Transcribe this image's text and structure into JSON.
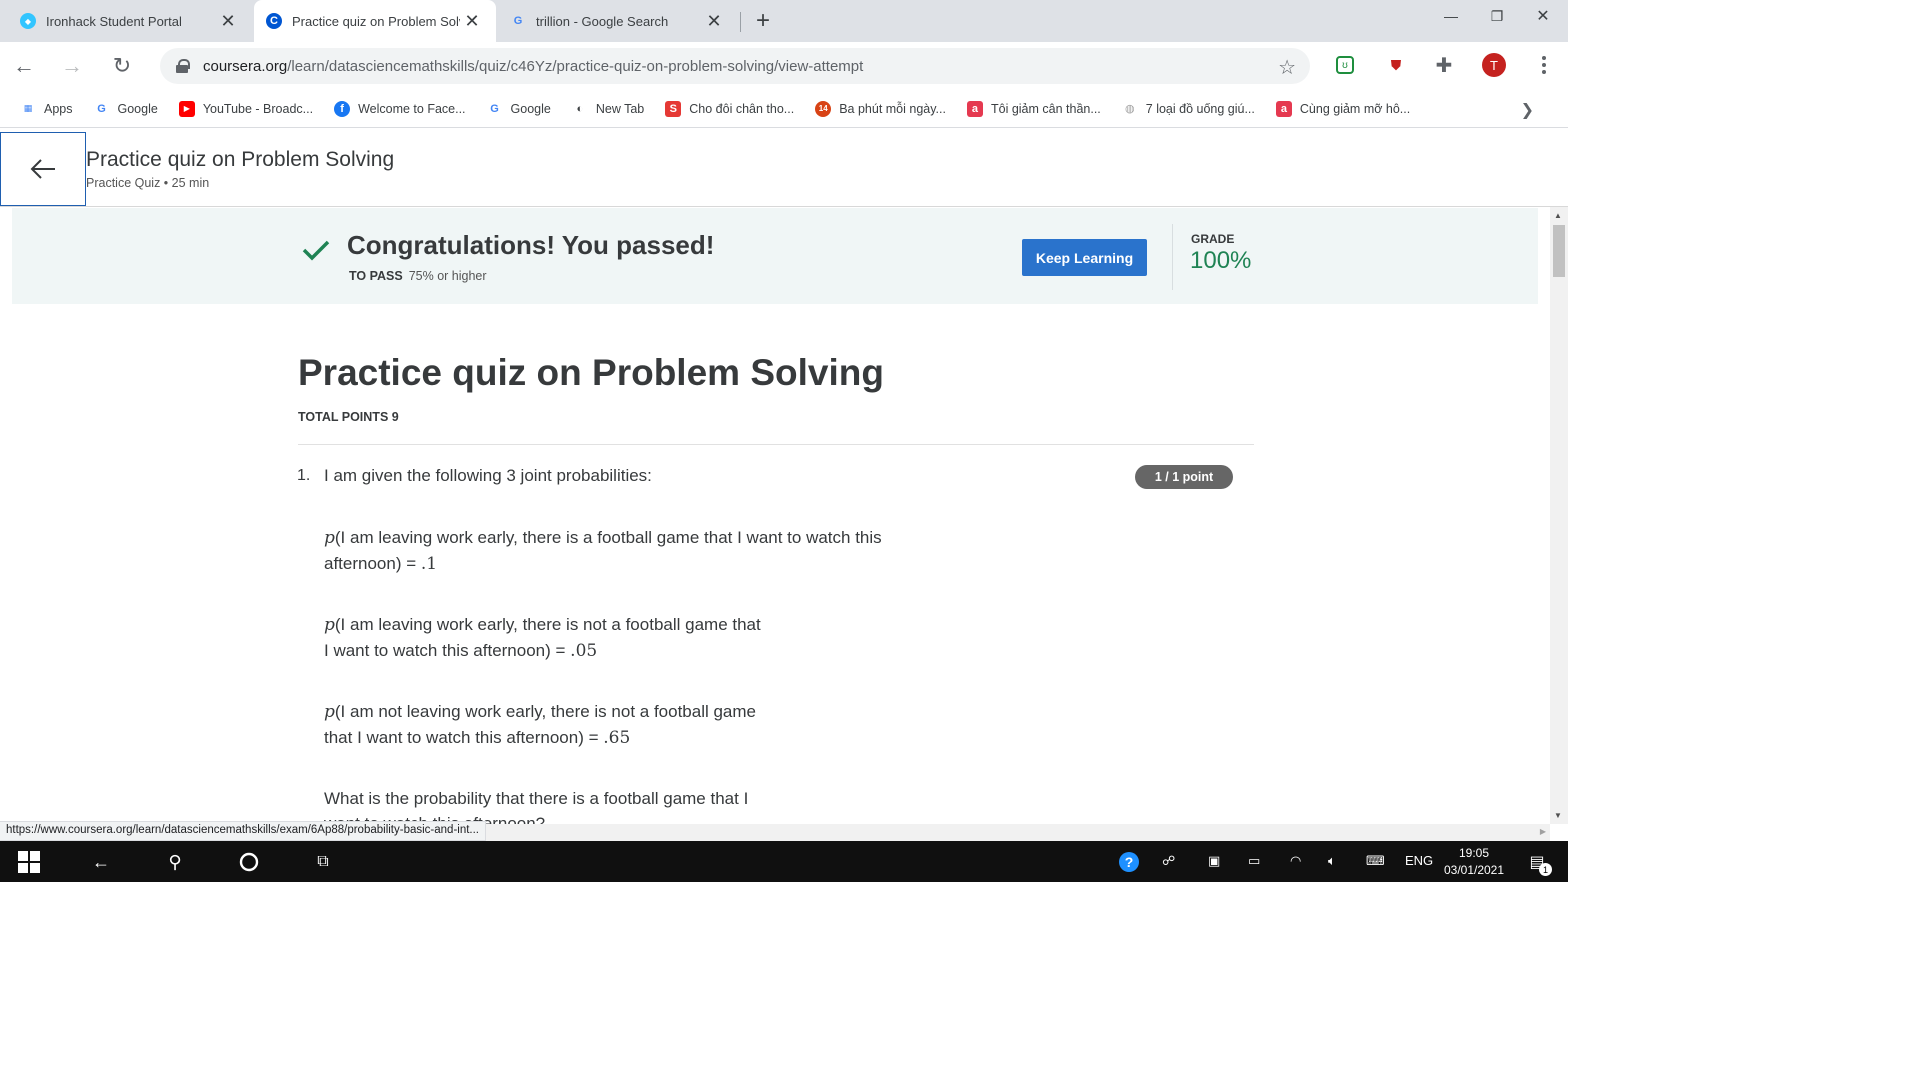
{
  "browser": {
    "tabs": [
      {
        "title": "Ironhack Student Portal",
        "icon": "ironhack-icon",
        "color": "#32c5ff",
        "active": false
      },
      {
        "title": "Practice quiz on Problem Solvi",
        "icon": "coursera-icon",
        "color": "#0056d2",
        "active": true
      },
      {
        "title": "trillion - Google Search",
        "icon": "google-icon",
        "color": "#4285f4",
        "active": false
      }
    ],
    "new_tab_symbol": "+",
    "url_domain": "coursera.org",
    "url_path": "/learn/datasciencemathskills/quiz/c46Yz/practice-quiz-on-problem-solving/view-attempt",
    "profile_initial": "T",
    "bookmarks": [
      {
        "label": "Apps",
        "icon": "apps-grid-icon",
        "glyph": "⋮⋮⋮",
        "color": "#4285f4"
      },
      {
        "label": "Google",
        "icon": "google-icon",
        "glyph": "G",
        "color": "#4285f4"
      },
      {
        "label": "YouTube - Broadc...",
        "icon": "youtube-icon",
        "glyph": "▶",
        "color": "#ff0000"
      },
      {
        "label": "Welcome to Face...",
        "icon": "facebook-icon",
        "glyph": "f",
        "color": "#1877f2"
      },
      {
        "label": "Google",
        "icon": "google-icon",
        "glyph": "G",
        "color": "#4285f4"
      },
      {
        "label": "New Tab",
        "icon": "new-tab-icon",
        "glyph": "◐",
        "color": "#3c4043"
      },
      {
        "label": "Cho đôi chân tho...",
        "icon": "s-icon",
        "glyph": "S",
        "color": "#e53935"
      },
      {
        "label": "Ba phút mỗi ngày...",
        "icon": "14-icon",
        "glyph": "14",
        "color": "#d84315"
      },
      {
        "label": "Tôi giảm cân thần...",
        "icon": "a-icon",
        "glyph": "a",
        "color": "#e53950"
      },
      {
        "label": "7 loại đồ uống giú...",
        "icon": "globe-icon",
        "glyph": "◍",
        "color": "#9e9e9e"
      },
      {
        "label": "Cùng giảm mỡ hô...",
        "icon": "a-icon",
        "glyph": "a",
        "color": "#e53950"
      }
    ],
    "status_url": "https://www.coursera.org/learn/datasciencemathskills/exam/6Ap88/probability-basic-and-int..."
  },
  "header": {
    "title": "Practice quiz on Problem Solving",
    "subtitle": "Practice Quiz • 25 min"
  },
  "banner": {
    "message": "Congratulations! You passed!",
    "to_pass_label": "TO PASS",
    "to_pass_value": "75% or higher",
    "button_label": "Keep Learning",
    "grade_label": "GRADE",
    "grade_value": "100%",
    "success_color": "#1f8354",
    "button_color": "#2a73cc"
  },
  "quiz": {
    "title": "Practice quiz on Problem Solving",
    "total_points": "TOTAL POINTS 9",
    "question": {
      "number": "1.",
      "text": "I am given the following 3 joint probabilities:",
      "points_badge": "1 / 1 point",
      "paragraphs": [
        {
          "lines": [
            "(I am leaving work early, there is a football game that I want to watch this",
            "afternoon) = "
          ],
          "value": ".1"
        },
        {
          "lines": [
            "(I am leaving work early, there is not a football game that",
            "I want to watch this afternoon) = "
          ],
          "value": ".05"
        },
        {
          "lines": [
            "(I am not leaving work early, there is not a football game",
            "that I want to watch this afternoon) = "
          ],
          "value": ".65"
        }
      ],
      "prob_symbol": "p",
      "prompt_lines": [
        "What is the probability that there is a football game that I",
        "want to watch this afternoon?"
      ]
    }
  },
  "taskbar": {
    "language": "ENG",
    "time": "19:05",
    "date": "03/01/2021",
    "notification_count": "1"
  }
}
